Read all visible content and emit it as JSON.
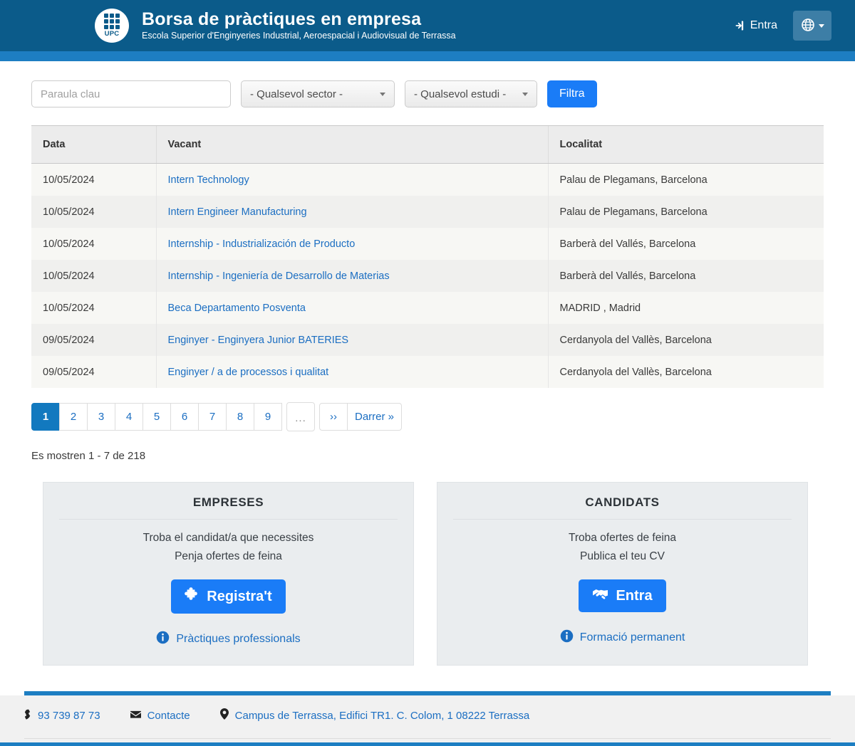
{
  "header": {
    "logo_text": "UPC",
    "title": "Borsa de pràctiques en empresa",
    "subtitle": "Escola Superior d'Enginyeries Industrial, Aeroespacial i Audiovisual de Terrassa",
    "login_label": "Entra",
    "login_icon": "sign-in-icon",
    "lang_icon": "globe-icon",
    "bg_color": "#0b5b8a",
    "accent_color": "#1d7ec2"
  },
  "filters": {
    "keyword_placeholder": "Paraula clau",
    "keyword_value": "",
    "sector_selected": "- Qualsevol sector -",
    "study_selected": "- Qualsevol estudi -",
    "filter_button": "Filtra",
    "filter_button_color": "#1a7cf7"
  },
  "table": {
    "columns": [
      "Data",
      "Vacant",
      "Localitat"
    ],
    "rows": [
      {
        "data": "10/05/2024",
        "vacant": "Intern Technology",
        "localitat": "Palau de Plegamans, Barcelona"
      },
      {
        "data": "10/05/2024",
        "vacant": "Intern Engineer Manufacturing",
        "localitat": "Palau de Plegamans, Barcelona"
      },
      {
        "data": "10/05/2024",
        "vacant": "Internship - Industrialización de Producto",
        "localitat": "Barberà del Vallés, Barcelona"
      },
      {
        "data": "10/05/2024",
        "vacant": "Internship - Ingeniería de Desarrollo de Materias",
        "localitat": "Barberà del Vallés, Barcelona"
      },
      {
        "data": "10/05/2024",
        "vacant": "Beca Departamento Posventa",
        "localitat": "MADRID , Madrid"
      },
      {
        "data": "09/05/2024",
        "vacant": "Enginyer - Enginyera Junior BATERIES",
        "localitat": "Cerdanyola del Vallès, Barcelona"
      },
      {
        "data": "09/05/2024",
        "vacant": "Enginyer / a de processos i qualitat",
        "localitat": "Cerdanyola del Vallès, Barcelona"
      }
    ]
  },
  "pagination": {
    "pages": [
      "1",
      "2",
      "3",
      "4",
      "5",
      "6",
      "7",
      "8",
      "9"
    ],
    "active": "1",
    "ellipsis": "...",
    "next_label": "››",
    "last_label": "Darrer »",
    "active_color": "#1279bf",
    "summary": "Es mostren 1 - 7 de 218"
  },
  "panels": [
    {
      "title": "EMPRESES",
      "line1": "Troba el candidat/a que necessites",
      "line2": "Penja ofertes de feina",
      "button_label": "Registra't",
      "button_icon": "puzzle-piece-icon",
      "link_label": "Pràctiques professionals",
      "link_icon": "info-circle-icon"
    },
    {
      "title": "CANDIDATS",
      "line1": "Troba ofertes de feina",
      "line2": "Publica el teu CV",
      "button_label": "Entra",
      "button_icon": "handshake-icon",
      "link_label": "Formació permanent",
      "link_icon": "info-circle-icon"
    }
  ],
  "footer": {
    "phone": "93 739 87 73",
    "phone_icon": "phone-icon",
    "contact": "Contacte",
    "contact_icon": "envelope-icon",
    "address": "Campus de Terrassa, Edifici TR1. C. Colom, 1 08222 Terrassa",
    "address_icon": "map-pin-icon",
    "accent_color": "#1d7ec2"
  }
}
